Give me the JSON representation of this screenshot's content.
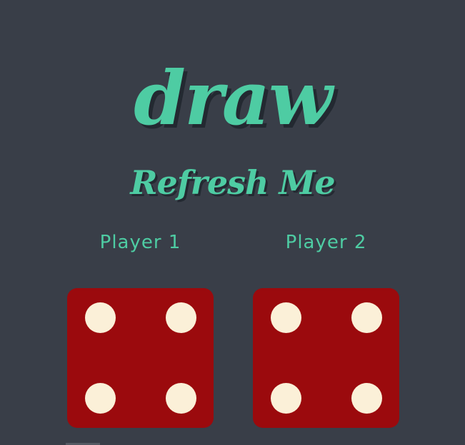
{
  "game": {
    "title": "draw",
    "subtitle": "Refresh Me"
  },
  "players": [
    {
      "label": "Player 1",
      "die_value": 4
    },
    {
      "label": "Player 2",
      "die_value": 4
    }
  ],
  "colors": {
    "background": "#393e48",
    "accent": "#4ecca3",
    "die": "#9b0a0d",
    "pip": "#fbf0d8"
  }
}
